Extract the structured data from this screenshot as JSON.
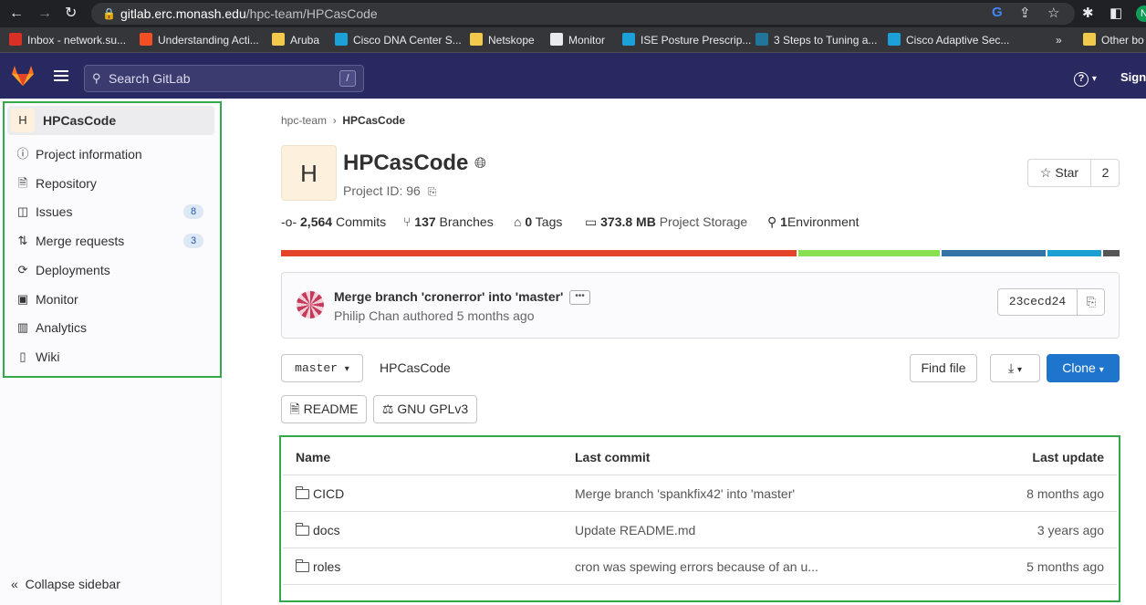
{
  "browser": {
    "url_host": "gitlab.erc.monash.edu",
    "url_path": "/hpc-team/HPCasCode",
    "bookmarks": [
      {
        "label": "Inbox - network.su...",
        "icon": "mail-icon",
        "color": "#d93025"
      },
      {
        "label": "Understanding Acti...",
        "icon": "windows-icon",
        "color": "#f25022"
      },
      {
        "label": "Aruba",
        "icon": "folder-icon",
        "color": "#f2c94c"
      },
      {
        "label": "Cisco DNA Center S...",
        "icon": "cisco-icon",
        "color": "#1ba0d7"
      },
      {
        "label": "Netskope",
        "icon": "folder-icon",
        "color": "#f2c94c"
      },
      {
        "label": "Monitor",
        "icon": "globe-icon",
        "color": "#e8eaed"
      },
      {
        "label": "ISE Posture Prescrip...",
        "icon": "cisco-icon",
        "color": "#1ba0d7"
      },
      {
        "label": "3 Steps to Tuning a...",
        "icon": "wordpress-icon",
        "color": "#21759b"
      },
      {
        "label": "Cisco Adaptive Sec...",
        "icon": "cisco-icon",
        "color": "#1ba0d7"
      },
      {
        "label": "Other bo",
        "icon": "folder-icon",
        "color": "#f2c94c"
      }
    ],
    "overflow": "»",
    "profile_initial": "N"
  },
  "header": {
    "search_placeholder": "Search GitLab",
    "search_shortcut": "/",
    "help": "?",
    "sign_in": "Sign"
  },
  "sidebar": {
    "project_initial": "H",
    "project_name": "HPCasCode",
    "items": [
      {
        "label": "Project information",
        "icon": "info-icon"
      },
      {
        "label": "Repository",
        "icon": "document-icon"
      },
      {
        "label": "Issues",
        "icon": "issues-icon",
        "badge": "8"
      },
      {
        "label": "Merge requests",
        "icon": "merge-request-icon",
        "badge": "3"
      },
      {
        "label": "Deployments",
        "icon": "deployments-icon"
      },
      {
        "label": "Monitor",
        "icon": "monitor-icon"
      },
      {
        "label": "Analytics",
        "icon": "analytics-icon"
      },
      {
        "label": "Wiki",
        "icon": "book-icon"
      }
    ],
    "collapse_label": "Collapse sidebar"
  },
  "breadcrumb": {
    "parent": "hpc-team",
    "sep": "›",
    "current": "HPCasCode"
  },
  "project": {
    "initial": "H",
    "name": "HPCasCode",
    "id_label": "Project ID: 96",
    "star_label": "Star",
    "star_count": "2"
  },
  "stats": {
    "commits_num": "2,564",
    "commits_label": "Commits",
    "branches_num": "137",
    "branches_label": "Branches",
    "tags_num": "0",
    "tags_label": "Tags",
    "storage_num": "373.8 MB",
    "storage_label": "Project Storage",
    "env_num": "1",
    "env_label": "Environment"
  },
  "language_bar": [
    {
      "share": 0.62,
      "color": "#e24329"
    },
    {
      "share": 0.17,
      "color": "#89e051"
    },
    {
      "share": 0.125,
      "color": "#3572a5"
    },
    {
      "share": 0.065,
      "color": "#1b9fd5"
    },
    {
      "share": 0.02,
      "color": "#555555"
    }
  ],
  "last_commit": {
    "title": "Merge branch 'cronerror' into 'master'",
    "dots": "•••",
    "author_line": "Philip Chan authored 5 months ago",
    "sha": "23cecd24"
  },
  "toolbar": {
    "branch": "master",
    "path": "HPCasCode",
    "find_file": "Find file",
    "clone": "Clone",
    "readme": "README",
    "license": "GNU GPLv3"
  },
  "files": {
    "headers": {
      "name": "Name",
      "last_commit": "Last commit",
      "last_update": "Last update"
    },
    "rows": [
      {
        "name": "CICD",
        "commit": "Merge branch 'spankfix42' into 'master'",
        "updated": "8 months ago"
      },
      {
        "name": "docs",
        "commit": "Update README.md",
        "updated": "3 years ago"
      },
      {
        "name": "roles",
        "commit": "cron was spewing errors because of an u...",
        "updated": "5 months ago"
      }
    ]
  }
}
